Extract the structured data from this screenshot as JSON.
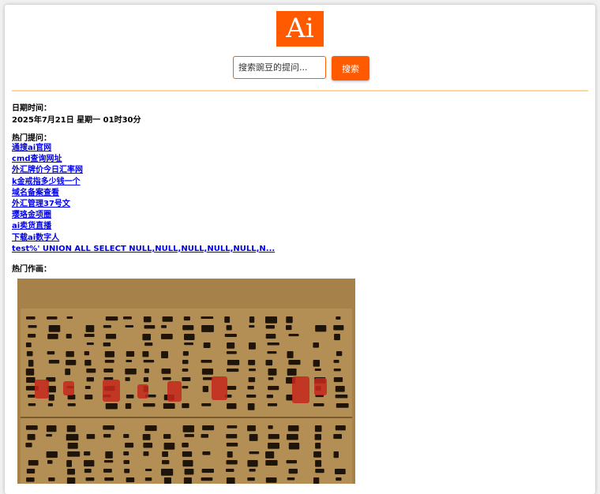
{
  "logo_text": "Ai",
  "search": {
    "placeholder": "搜索豌豆的提问...",
    "button_label": "搜索"
  },
  "datetime": {
    "label": "日期时间：",
    "value": "2025年7月21日 星期一 01时30分"
  },
  "hot_questions": {
    "label": "热门提问：",
    "items": [
      "通搜ai官网",
      "cmd查询网址",
      "外汇牌价今日汇率网",
      "k金戒指多少钱一个",
      "域名备案查看",
      "外汇管理37号文",
      "璎珞金项圈",
      "ai卖货直播",
      "下载ai数字人",
      "test%' UNION ALL SELECT NULL,NULL,NULL,NULL,NULL,N..."
    ]
  },
  "hot_paintings": {
    "label": "热门作画："
  },
  "colors": {
    "accent": "#ff5a00",
    "divider": "#ffd79a",
    "link": "#0000ee",
    "artwork_bg": "#a27c45",
    "seal": "#c4281c"
  }
}
